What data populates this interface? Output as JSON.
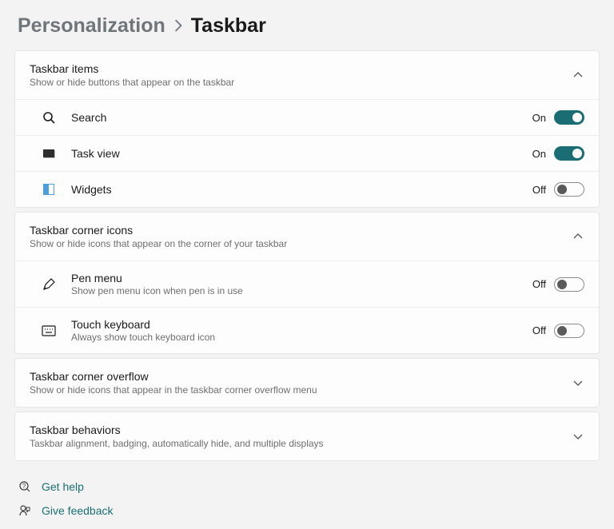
{
  "breadcrumb": {
    "parent": "Personalization",
    "current": "Taskbar"
  },
  "sections": {
    "items": {
      "title": "Taskbar items",
      "subtitle": "Show or hide buttons that appear on the taskbar",
      "rows": {
        "search": {
          "label": "Search",
          "state": "On"
        },
        "taskview": {
          "label": "Task view",
          "state": "On"
        },
        "widgets": {
          "label": "Widgets",
          "state": "Off"
        }
      }
    },
    "corner_icons": {
      "title": "Taskbar corner icons",
      "subtitle": "Show or hide icons that appear on the corner of your taskbar",
      "rows": {
        "pen": {
          "label": "Pen menu",
          "sub": "Show pen menu icon when pen is in use",
          "state": "Off"
        },
        "touchkb": {
          "label": "Touch keyboard",
          "sub": "Always show touch keyboard icon",
          "state": "Off"
        }
      }
    },
    "overflow": {
      "title": "Taskbar corner overflow",
      "subtitle": "Show or hide icons that appear in the taskbar corner overflow menu"
    },
    "behaviors": {
      "title": "Taskbar behaviors",
      "subtitle": "Taskbar alignment, badging, automatically hide, and multiple displays"
    }
  },
  "links": {
    "help": "Get help",
    "feedback": "Give feedback"
  }
}
